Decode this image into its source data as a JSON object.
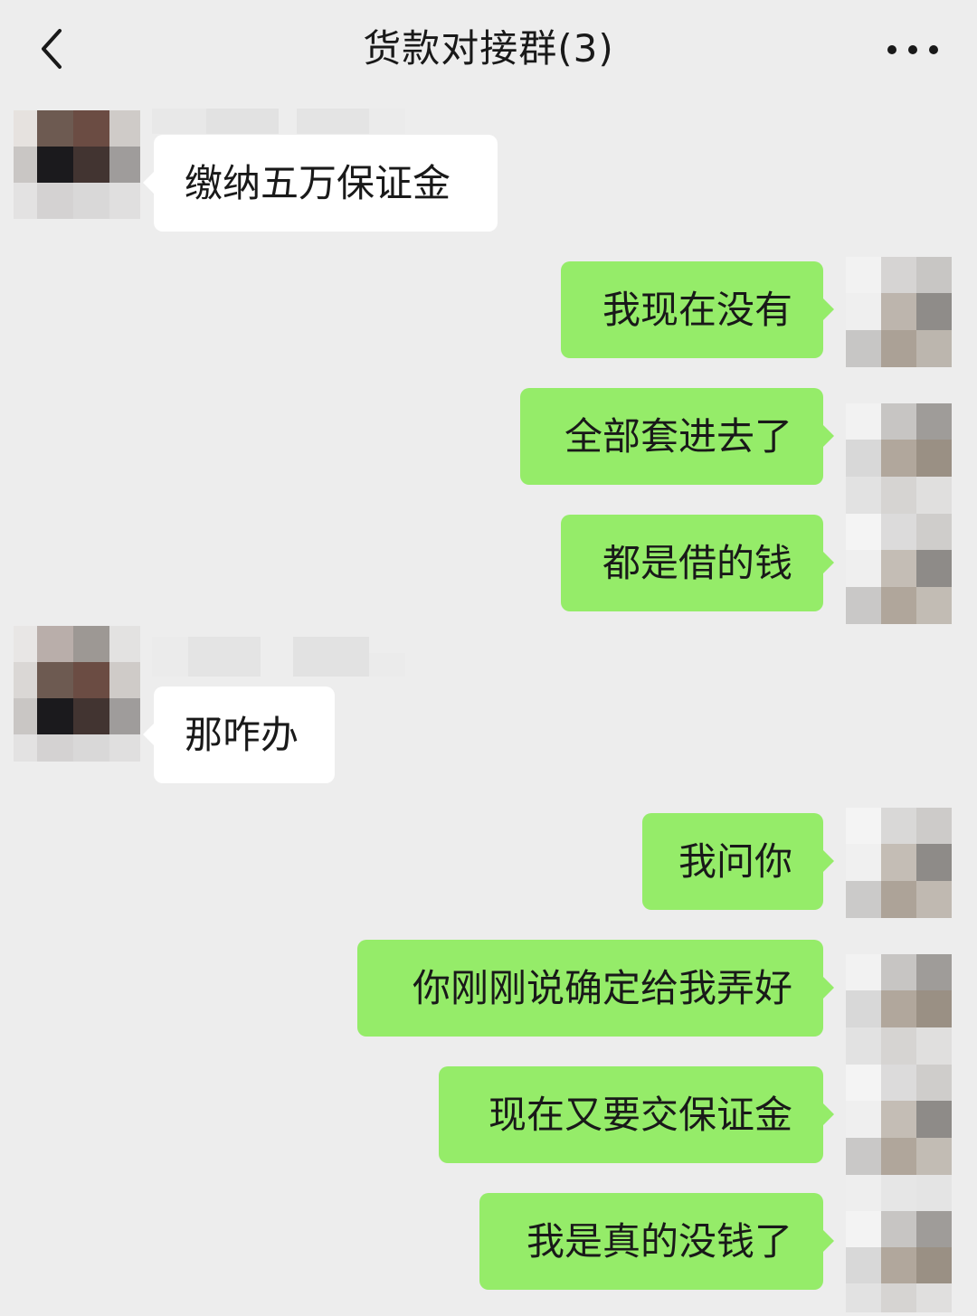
{
  "header": {
    "title": "货款对接群(3)",
    "back_icon": "chevron-left-icon",
    "more_icon": "more-dots-icon"
  },
  "messages": [
    {
      "direction": "in",
      "text": "缴纳五万保证金"
    },
    {
      "direction": "out",
      "text": "我现在没有"
    },
    {
      "direction": "out",
      "text": "全部套进去了"
    },
    {
      "direction": "out",
      "text": "都是借的钱"
    },
    {
      "direction": "in",
      "text": "那咋办"
    },
    {
      "direction": "out",
      "text": "我问你"
    },
    {
      "direction": "out",
      "text": "你刚刚说确定给我弄好"
    },
    {
      "direction": "out",
      "text": "现在又要交保证金"
    },
    {
      "direction": "out",
      "text": "我是真的没钱了"
    }
  ],
  "colors": {
    "background": "#ededed",
    "bubble_out": "#95ec69",
    "bubble_in": "#ffffff",
    "text": "#191919"
  }
}
